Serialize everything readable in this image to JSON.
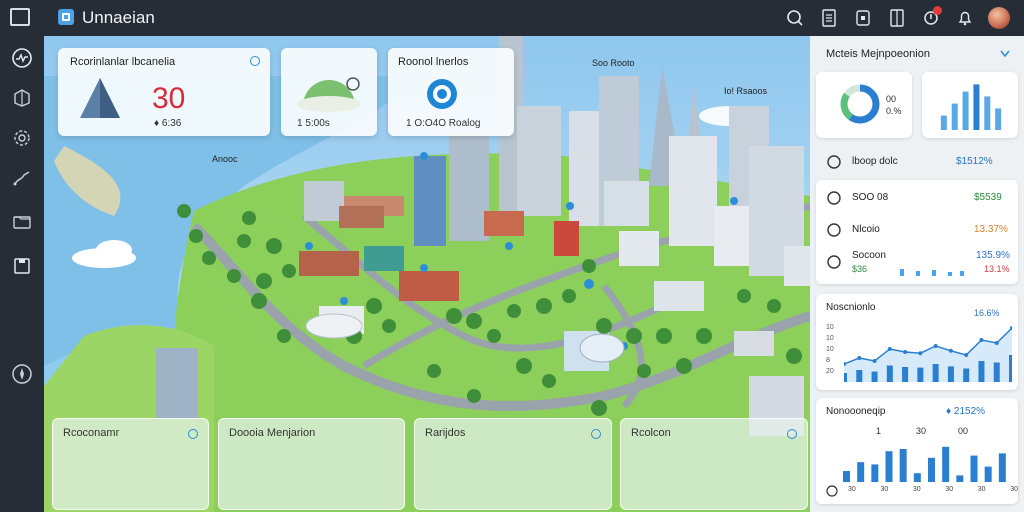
{
  "app": {
    "title": "Unnaeian"
  },
  "topbar": {
    "icons": [
      "search-icon",
      "document-icon",
      "tablet-icon",
      "panel-icon",
      "notification-icon",
      "bell-icon"
    ],
    "avatar": "user-avatar"
  },
  "sidebar": {
    "icons": [
      "activity-icon",
      "cube-icon",
      "gear-icon",
      "route-icon",
      "folder-icon",
      "save-icon",
      "compass-icon"
    ]
  },
  "map_cards": {
    "card1": {
      "title": "Rcorinlanlar lbcanelia",
      "value": "30",
      "sub": "♦ 6:36"
    },
    "card2": {
      "sub": "1 5:00s"
    },
    "card3": {
      "title": "Roonol lnerlos",
      "sub": "1 O:O4O Roalog"
    }
  },
  "map_labels": {
    "left": "Anooc",
    "top": "Soo Rooto",
    "right": "Io! Rsaoos"
  },
  "bottom_cards": [
    "Rcoconamr",
    "Doooia Menjarion",
    "Rarijdos",
    "Rcolcon"
  ],
  "rpanel": {
    "header": "Mcteis Mejnpoeonion",
    "donut_caption": [
      "00",
      "0.%"
    ],
    "list_header": {
      "label": "lboop dolc",
      "value": "$1512%"
    },
    "rows": [
      {
        "label": "SOO 08",
        "value": "$5539",
        "color": "#2e8b3e"
      },
      {
        "label": "Nlcoio",
        "value": "13.37%",
        "color": "#d9822b"
      },
      {
        "label": "Socoon",
        "sub": "$36",
        "value": "135.9%",
        "value2": "13.1%",
        "color": "#2a72c9",
        "color2": "#d23a3a"
      }
    ],
    "line_chart": {
      "title": "Noscnionlo",
      "value": "16.6%",
      "y_ticks": [
        "10",
        "10",
        "10",
        "8",
        "20"
      ]
    },
    "bar_chart": {
      "title": "Nonoooneqip",
      "value": "♦ 2152%",
      "top_labels": [
        "1",
        "30",
        "00"
      ],
      "x_ticks": [
        "30",
        "30",
        "30",
        "30",
        "30",
        "30"
      ]
    }
  },
  "chart_data": [
    {
      "type": "bar",
      "values": [
        30,
        55,
        80,
        95,
        70,
        45
      ],
      "title": ""
    },
    {
      "type": "line",
      "values": [
        30,
        40,
        35,
        55,
        50,
        48,
        60,
        52,
        45,
        70,
        65,
        90
      ]
    },
    {
      "type": "bar",
      "values": [
        25,
        45,
        40,
        70,
        75,
        20,
        55,
        80,
        15,
        60,
        35,
        65
      ]
    }
  ]
}
